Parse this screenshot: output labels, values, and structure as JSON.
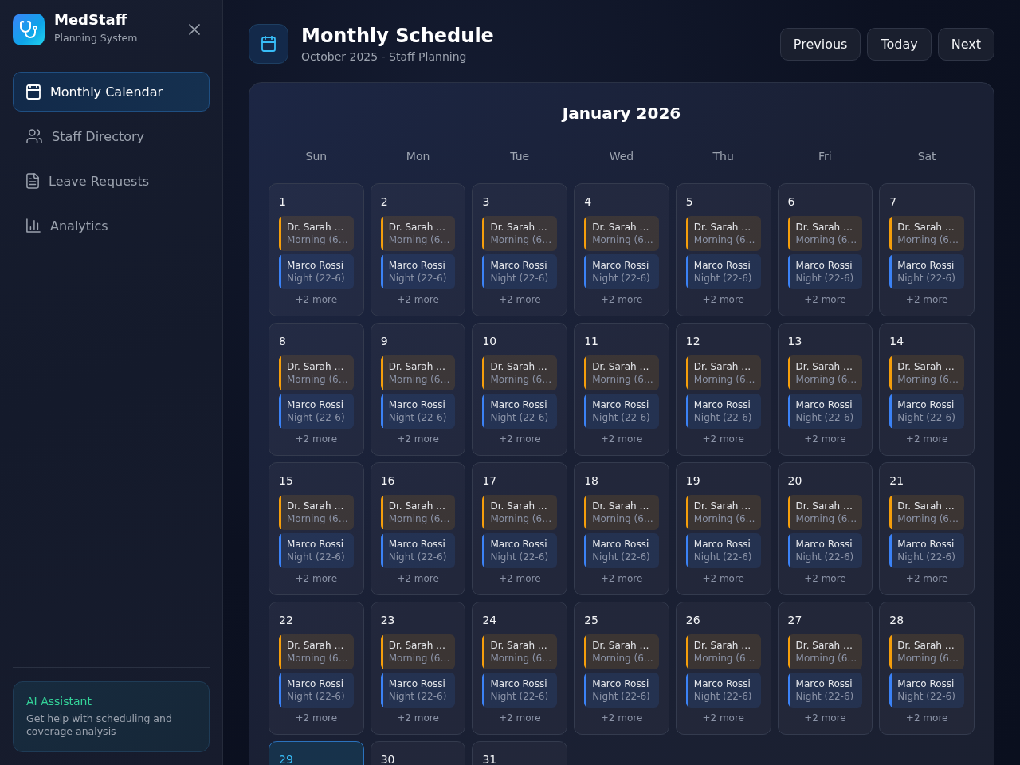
{
  "sidebar": {
    "brand": {
      "name": "MedStaff",
      "tagline": "Planning System"
    },
    "nav": [
      {
        "label": "Monthly Calendar",
        "selected": true
      },
      {
        "label": "Staff Directory",
        "selected": false
      },
      {
        "label": "Leave Requests",
        "selected": false
      },
      {
        "label": "Analytics",
        "selected": false
      }
    ],
    "assistant": {
      "title": "AI Assistant",
      "description": "Get help with scheduling and coverage analysis"
    }
  },
  "header": {
    "title": "Monthly Schedule",
    "subtitle": "October 2025 - Staff Planning",
    "buttons": [
      "Previous",
      "Today",
      "Next"
    ]
  },
  "calendar": {
    "month": "January 2026",
    "weekdays": [
      "Sun",
      "Mon",
      "Tue",
      "Wed",
      "Thu",
      "Fri",
      "Sat"
    ],
    "days": [
      {
        "day": "1",
        "today": false,
        "shifts": [
          {
            "name": "Dr. Sarah …",
            "time": "Morning (6…",
            "color": "#f59e0b"
          },
          {
            "name": "Marco Rossi",
            "time": "Night (22-6)",
            "color": "#3b82f6"
          }
        ],
        "more": "+2 more"
      },
      {
        "day": "2",
        "today": false,
        "shifts": [
          {
            "name": "Dr. Sarah …",
            "time": "Morning (6…",
            "color": "#f59e0b"
          },
          {
            "name": "Marco Rossi",
            "time": "Night (22-6)",
            "color": "#3b82f6"
          }
        ],
        "more": "+2 more"
      },
      {
        "day": "3",
        "today": false,
        "shifts": [
          {
            "name": "Dr. Sarah …",
            "time": "Morning (6…",
            "color": "#f59e0b"
          },
          {
            "name": "Marco Rossi",
            "time": "Night (22-6)",
            "color": "#3b82f6"
          }
        ],
        "more": "+2 more"
      },
      {
        "day": "4",
        "today": false,
        "shifts": [
          {
            "name": "Dr. Sarah …",
            "time": "Morning (6…",
            "color": "#f59e0b"
          },
          {
            "name": "Marco Rossi",
            "time": "Night (22-6)",
            "color": "#3b82f6"
          }
        ],
        "more": "+2 more"
      },
      {
        "day": "5",
        "today": false,
        "shifts": [
          {
            "name": "Dr. Sarah …",
            "time": "Morning (6…",
            "color": "#f59e0b"
          },
          {
            "name": "Marco Rossi",
            "time": "Night (22-6)",
            "color": "#3b82f6"
          }
        ],
        "more": "+2 more"
      },
      {
        "day": "6",
        "today": false,
        "shifts": [
          {
            "name": "Dr. Sarah …",
            "time": "Morning (6…",
            "color": "#f59e0b"
          },
          {
            "name": "Marco Rossi",
            "time": "Night (22-6)",
            "color": "#3b82f6"
          }
        ],
        "more": "+2 more"
      },
      {
        "day": "7",
        "today": false,
        "shifts": [
          {
            "name": "Dr. Sarah …",
            "time": "Morning (6…",
            "color": "#f59e0b"
          },
          {
            "name": "Marco Rossi",
            "time": "Night (22-6)",
            "color": "#3b82f6"
          }
        ],
        "more": "+2 more"
      },
      {
        "day": "8",
        "today": false,
        "shifts": [
          {
            "name": "Dr. Sarah …",
            "time": "Morning (6…",
            "color": "#f59e0b"
          },
          {
            "name": "Marco Rossi",
            "time": "Night (22-6)",
            "color": "#3b82f6"
          }
        ],
        "more": "+2 more"
      },
      {
        "day": "9",
        "today": false,
        "shifts": [
          {
            "name": "Dr. Sarah …",
            "time": "Morning (6…",
            "color": "#f59e0b"
          },
          {
            "name": "Marco Rossi",
            "time": "Night (22-6)",
            "color": "#3b82f6"
          }
        ],
        "more": "+2 more"
      },
      {
        "day": "10",
        "today": false,
        "shifts": [
          {
            "name": "Dr. Sarah …",
            "time": "Morning (6…",
            "color": "#f59e0b"
          },
          {
            "name": "Marco Rossi",
            "time": "Night (22-6)",
            "color": "#3b82f6"
          }
        ],
        "more": "+2 more"
      },
      {
        "day": "11",
        "today": false,
        "shifts": [
          {
            "name": "Dr. Sarah …",
            "time": "Morning (6…",
            "color": "#f59e0b"
          },
          {
            "name": "Marco Rossi",
            "time": "Night (22-6)",
            "color": "#3b82f6"
          }
        ],
        "more": "+2 more"
      },
      {
        "day": "12",
        "today": false,
        "shifts": [
          {
            "name": "Dr. Sarah …",
            "time": "Morning (6…",
            "color": "#f59e0b"
          },
          {
            "name": "Marco Rossi",
            "time": "Night (22-6)",
            "color": "#3b82f6"
          }
        ],
        "more": "+2 more"
      },
      {
        "day": "13",
        "today": false,
        "shifts": [
          {
            "name": "Dr. Sarah …",
            "time": "Morning (6…",
            "color": "#f59e0b"
          },
          {
            "name": "Marco Rossi",
            "time": "Night (22-6)",
            "color": "#3b82f6"
          }
        ],
        "more": "+2 more"
      },
      {
        "day": "14",
        "today": false,
        "shifts": [
          {
            "name": "Dr. Sarah …",
            "time": "Morning (6…",
            "color": "#f59e0b"
          },
          {
            "name": "Marco Rossi",
            "time": "Night (22-6)",
            "color": "#3b82f6"
          }
        ],
        "more": "+2 more"
      },
      {
        "day": "15",
        "today": false,
        "shifts": [
          {
            "name": "Dr. Sarah …",
            "time": "Morning (6…",
            "color": "#f59e0b"
          },
          {
            "name": "Marco Rossi",
            "time": "Night (22-6)",
            "color": "#3b82f6"
          }
        ],
        "more": "+2 more"
      },
      {
        "day": "16",
        "today": false,
        "shifts": [
          {
            "name": "Dr. Sarah …",
            "time": "Morning (6…",
            "color": "#f59e0b"
          },
          {
            "name": "Marco Rossi",
            "time": "Night (22-6)",
            "color": "#3b82f6"
          }
        ],
        "more": "+2 more"
      },
      {
        "day": "17",
        "today": false,
        "shifts": [
          {
            "name": "Dr. Sarah …",
            "time": "Morning (6…",
            "color": "#f59e0b"
          },
          {
            "name": "Marco Rossi",
            "time": "Night (22-6)",
            "color": "#3b82f6"
          }
        ],
        "more": "+2 more"
      },
      {
        "day": "18",
        "today": false,
        "shifts": [
          {
            "name": "Dr. Sarah …",
            "time": "Morning (6…",
            "color": "#f59e0b"
          },
          {
            "name": "Marco Rossi",
            "time": "Night (22-6)",
            "color": "#3b82f6"
          }
        ],
        "more": "+2 more"
      },
      {
        "day": "19",
        "today": false,
        "shifts": [
          {
            "name": "Dr. Sarah …",
            "time": "Morning (6…",
            "color": "#f59e0b"
          },
          {
            "name": "Marco Rossi",
            "time": "Night (22-6)",
            "color": "#3b82f6"
          }
        ],
        "more": "+2 more"
      },
      {
        "day": "20",
        "today": false,
        "shifts": [
          {
            "name": "Dr. Sarah …",
            "time": "Morning (6…",
            "color": "#f59e0b"
          },
          {
            "name": "Marco Rossi",
            "time": "Night (22-6)",
            "color": "#3b82f6"
          }
        ],
        "more": "+2 more"
      },
      {
        "day": "21",
        "today": false,
        "shifts": [
          {
            "name": "Dr. Sarah …",
            "time": "Morning (6…",
            "color": "#f59e0b"
          },
          {
            "name": "Marco Rossi",
            "time": "Night (22-6)",
            "color": "#3b82f6"
          }
        ],
        "more": "+2 more"
      },
      {
        "day": "22",
        "today": false,
        "shifts": [
          {
            "name": "Dr. Sarah …",
            "time": "Morning (6…",
            "color": "#f59e0b"
          },
          {
            "name": "Marco Rossi",
            "time": "Night (22-6)",
            "color": "#3b82f6"
          }
        ],
        "more": "+2 more"
      },
      {
        "day": "23",
        "today": false,
        "shifts": [
          {
            "name": "Dr. Sarah …",
            "time": "Morning (6…",
            "color": "#f59e0b"
          },
          {
            "name": "Marco Rossi",
            "time": "Night (22-6)",
            "color": "#3b82f6"
          }
        ],
        "more": "+2 more"
      },
      {
        "day": "24",
        "today": false,
        "shifts": [
          {
            "name": "Dr. Sarah …",
            "time": "Morning (6…",
            "color": "#f59e0b"
          },
          {
            "name": "Marco Rossi",
            "time": "Night (22-6)",
            "color": "#3b82f6"
          }
        ],
        "more": "+2 more"
      },
      {
        "day": "25",
        "today": false,
        "shifts": [
          {
            "name": "Dr. Sarah …",
            "time": "Morning (6…",
            "color": "#f59e0b"
          },
          {
            "name": "Marco Rossi",
            "time": "Night (22-6)",
            "color": "#3b82f6"
          }
        ],
        "more": "+2 more"
      },
      {
        "day": "26",
        "today": false,
        "shifts": [
          {
            "name": "Dr. Sarah …",
            "time": "Morning (6…",
            "color": "#f59e0b"
          },
          {
            "name": "Marco Rossi",
            "time": "Night (22-6)",
            "color": "#3b82f6"
          }
        ],
        "more": "+2 more"
      },
      {
        "day": "27",
        "today": false,
        "shifts": [
          {
            "name": "Dr. Sarah …",
            "time": "Morning (6…",
            "color": "#f59e0b"
          },
          {
            "name": "Marco Rossi",
            "time": "Night (22-6)",
            "color": "#3b82f6"
          }
        ],
        "more": "+2 more"
      },
      {
        "day": "28",
        "today": false,
        "shifts": [
          {
            "name": "Dr. Sarah …",
            "time": "Morning (6…",
            "color": "#f59e0b"
          },
          {
            "name": "Marco Rossi",
            "time": "Night (22-6)",
            "color": "#3b82f6"
          }
        ],
        "more": "+2 more"
      },
      {
        "day": "29",
        "today": true
      },
      {
        "day": "30",
        "today": false
      },
      {
        "day": "31",
        "today": false
      }
    ]
  }
}
